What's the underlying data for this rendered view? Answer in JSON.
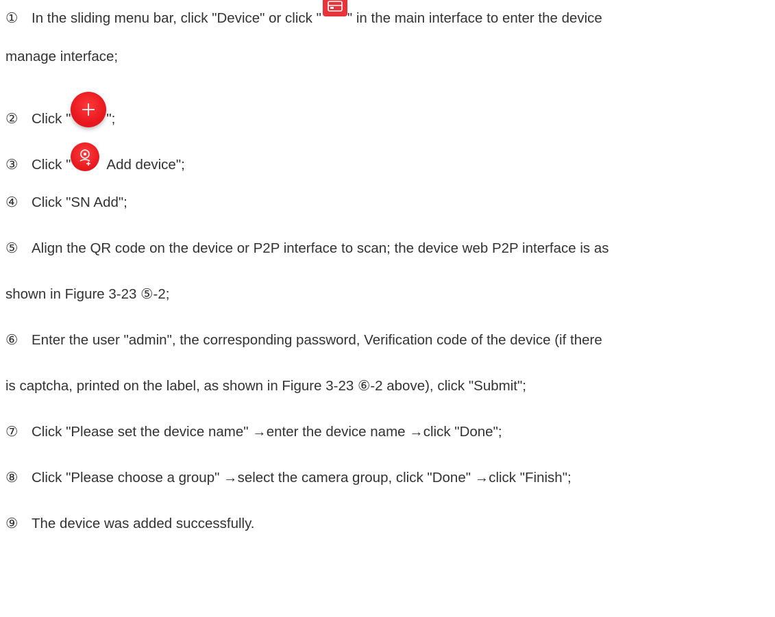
{
  "steps": [
    {
      "num": "①",
      "before": "In the sliding menu bar, click \"Device\" or click \"",
      "after": "\" in the main interface to enter the device"
    },
    {
      "continuation": "manage interface;"
    },
    {
      "num": "②",
      "before": "Click \"",
      "after": "\";"
    },
    {
      "num": "③",
      "before": "Click \"",
      "after": "Add device\";"
    },
    {
      "num": "④",
      "text": "Click \"SN Add\";"
    },
    {
      "num": "⑤",
      "text": "Align the QR code on the device or P2P interface to scan; the device web P2P interface is as"
    },
    {
      "continuation": "shown in Figure 3-23 ⑤-2;"
    },
    {
      "num": "⑥",
      "text": "Enter the user \"admin\", the corresponding password, Verification code of the device (if there"
    },
    {
      "continuation": "is captcha, printed on the label, as shown in Figure 3-23 ⑥-2 above), click \"Submit\";"
    },
    {
      "num": "⑦",
      "text": "Click \"Please set the device name\"  →enter the device name  →click \"Done\";"
    },
    {
      "num": "⑧",
      "text": "Click \"Please choose a group\"  →select the camera group, click \"Done\"  →click \"Finish\";"
    },
    {
      "num": "⑨",
      "text": "The device was added successfully."
    }
  ],
  "icons": {
    "device": "device-manage-icon",
    "add": "plus-icon",
    "add_device": "add-camera-icon"
  },
  "colors": {
    "accent": "#e8191f",
    "text": "#333333"
  }
}
